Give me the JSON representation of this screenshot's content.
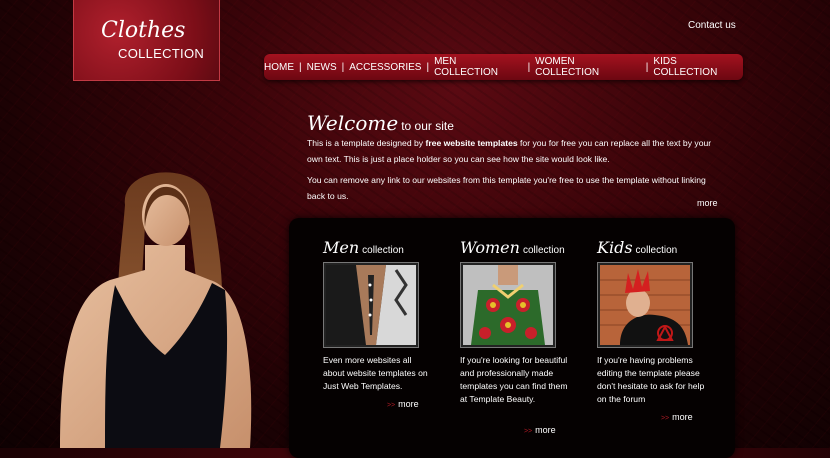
{
  "logo": {
    "line1": "Clothes",
    "line2": "COLLECTION"
  },
  "header": {
    "contact": "Contact us"
  },
  "nav": {
    "items": [
      {
        "label": "HOME"
      },
      {
        "label": "NEWS"
      },
      {
        "label": "ACCESSORIES"
      },
      {
        "label": "MEN COLLECTION"
      },
      {
        "label": "WOMEN COLLECTION"
      },
      {
        "label": "KIDS COLLECTION"
      }
    ]
  },
  "welcome": {
    "title_big": "Welcome",
    "title_small": "to our site",
    "p1_a": "This is a template designed by ",
    "p1_bold": "free website templates",
    "p1_b": " for you for free you can replace all the text by your own text. This is just a place holder so you can see how the site would look like.",
    "p2": "You can remove any link to our websites from this template you're free to use the template without linking back to us.",
    "more": "more"
  },
  "collections": [
    {
      "title_big": "Men",
      "title_small": "collection",
      "text": "Even more websites all about website templates on Just Web Templates.",
      "more": "more",
      "arrows": "> >"
    },
    {
      "title_big": "Women",
      "title_small": "collection",
      "text": "If you're looking for beautiful and professionally made templates you can find them at Template Beauty.",
      "more": "more",
      "arrows": "> >"
    },
    {
      "title_big": "Kids",
      "title_small": "collection",
      "text": "If you're having problems editing the template please don't hesitate to ask for help on the forum",
      "more": "more",
      "arrows": "> >"
    }
  ]
}
